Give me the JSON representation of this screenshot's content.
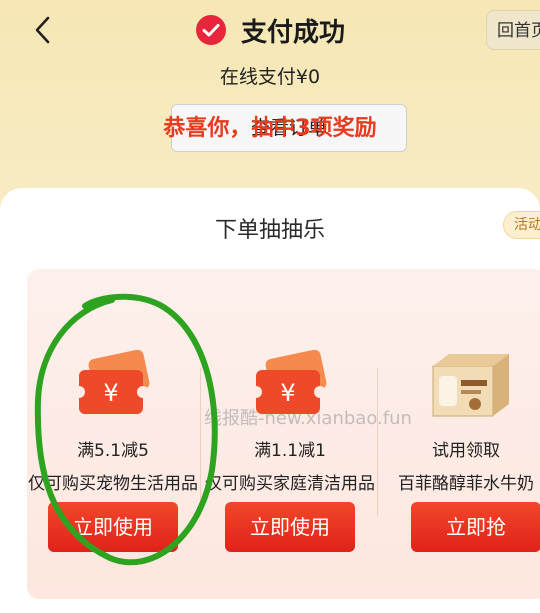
{
  "header": {
    "title": "支付成功",
    "home_label": "回首页",
    "payment_text": "在线支付¥0",
    "view_order_label": "查看订单"
  },
  "lottery": {
    "title": "下单抽抽乐",
    "activity_tag": "活动规则",
    "congrats_text": "恭喜你，抽中3项奖励",
    "prizes": [
      {
        "name": "满5.1减5",
        "desc": "仅可购买宠物生活用品",
        "button": "立即使用",
        "icon": "coupon-ticket-icon"
      },
      {
        "name": "满1.1减1",
        "desc": "仅可购买家庭清洁用品",
        "button": "立即使用",
        "icon": "coupon-ticket-icon"
      },
      {
        "name": "试用领取",
        "desc": "百菲酪醇菲水牛奶",
        "button": "立即抢",
        "icon": "milk-product-image"
      }
    ]
  },
  "watermark": "线报酷-new.xianbao.fun",
  "colors": {
    "accent_red": "#e83a1e",
    "button_red": "#e0221a",
    "check_red": "#e8253a",
    "marker_green": "#2ea31f"
  }
}
